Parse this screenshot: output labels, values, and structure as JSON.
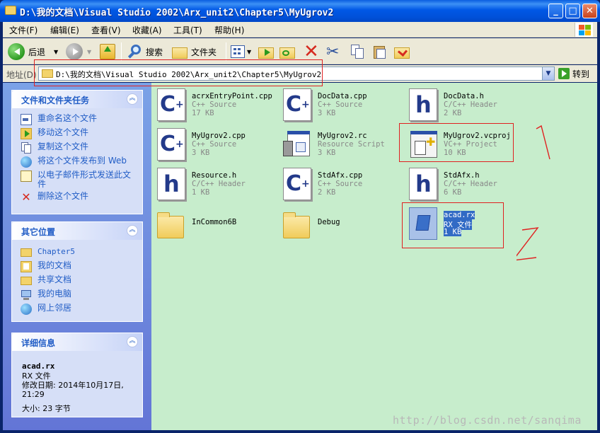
{
  "window": {
    "title": "D:\\我的文档\\Visual Studio 2002\\Arx_unit2\\Chapter5\\MyUgrov2",
    "buttons": {
      "minimize": "_",
      "maximize": "□",
      "close": "✕"
    }
  },
  "menu": [
    "文件(F)",
    "编辑(E)",
    "查看(V)",
    "收藏(A)",
    "工具(T)",
    "帮助(H)"
  ],
  "toolbar": {
    "back_label": "后退",
    "search_label": "搜索",
    "folders_label": "文件夹"
  },
  "address": {
    "label": "地址(D)",
    "path": "D:\\我的文档\\Visual Studio 2002\\Arx_unit2\\Chapter5\\MyUgrov2",
    "go_label": "转到"
  },
  "sidebar": {
    "tasks": {
      "title": "文件和文件夹任务",
      "items": [
        {
          "label": "重命名这个文件",
          "icon": "rename-icon"
        },
        {
          "label": "移动这个文件",
          "icon": "move-icon"
        },
        {
          "label": "复制这个文件",
          "icon": "copy-icon"
        },
        {
          "label": "将这个文件发布到 Web",
          "icon": "publish-web-icon"
        },
        {
          "label": "以电子邮件形式发送此文件",
          "icon": "email-icon"
        },
        {
          "label": "删除这个文件",
          "icon": "delete-icon"
        }
      ]
    },
    "places": {
      "title": "其它位置",
      "items": [
        {
          "label": "Chapter5",
          "icon": "folder-icon"
        },
        {
          "label": "我的文档",
          "icon": "my-documents-icon"
        },
        {
          "label": "共享文档",
          "icon": "shared-documents-icon"
        },
        {
          "label": "我的电脑",
          "icon": "my-computer-icon"
        },
        {
          "label": "网上邻居",
          "icon": "network-places-icon"
        }
      ]
    },
    "details": {
      "title": "详细信息",
      "name": "acad.rx",
      "type": "RX 文件",
      "modified": "修改日期: 2014年10月17日, 21:29",
      "size": "大小: 23 字节"
    }
  },
  "files": [
    {
      "name": "acrxEntryPoint.cpp",
      "type": "C++ Source",
      "size": "17 KB",
      "icon": "cpp-file-icon"
    },
    {
      "name": "DocData.cpp",
      "type": "C++ Source",
      "size": "3 KB",
      "icon": "cpp-file-icon"
    },
    {
      "name": "DocData.h",
      "type": "C/C++ Header",
      "size": "2 KB",
      "icon": "header-file-icon"
    },
    {
      "name": "MyUgrov2.cpp",
      "type": "C++ Source",
      "size": "3 KB",
      "icon": "cpp-file-icon"
    },
    {
      "name": "MyUgrov2.rc",
      "type": "Resource Script",
      "size": "3 KB",
      "icon": "resource-script-icon"
    },
    {
      "name": "MyUgrov2.vcproj",
      "type": "VC++ Project",
      "size": "10 KB",
      "icon": "vcproj-file-icon"
    },
    {
      "name": "Resource.h",
      "type": "C/C++ Header",
      "size": "1 KB",
      "icon": "header-file-icon"
    },
    {
      "name": "StdAfx.cpp",
      "type": "C++ Source",
      "size": "2 KB",
      "icon": "cpp-file-icon"
    },
    {
      "name": "StdAfx.h",
      "type": "C/C++ Header",
      "size": "6 KB",
      "icon": "header-file-icon"
    },
    {
      "name": "InCommon6B",
      "type": "",
      "size": "",
      "icon": "folder-icon"
    },
    {
      "name": "Debug",
      "type": "",
      "size": "",
      "icon": "folder-icon"
    },
    {
      "name": "acad.rx",
      "type": "RX 文件",
      "size": "1 KB",
      "icon": "rx-file-icon",
      "selected": true
    }
  ],
  "annotations": {
    "mark1": "1",
    "mark2": "2"
  },
  "watermark": "http://blog.csdn.net/sanqima",
  "colors": {
    "title_bar": "#0058e6",
    "sidebar": "#6375d6",
    "content_bg": "#c7edcc",
    "annotation": "#e02020",
    "selection": "#316ac5"
  }
}
